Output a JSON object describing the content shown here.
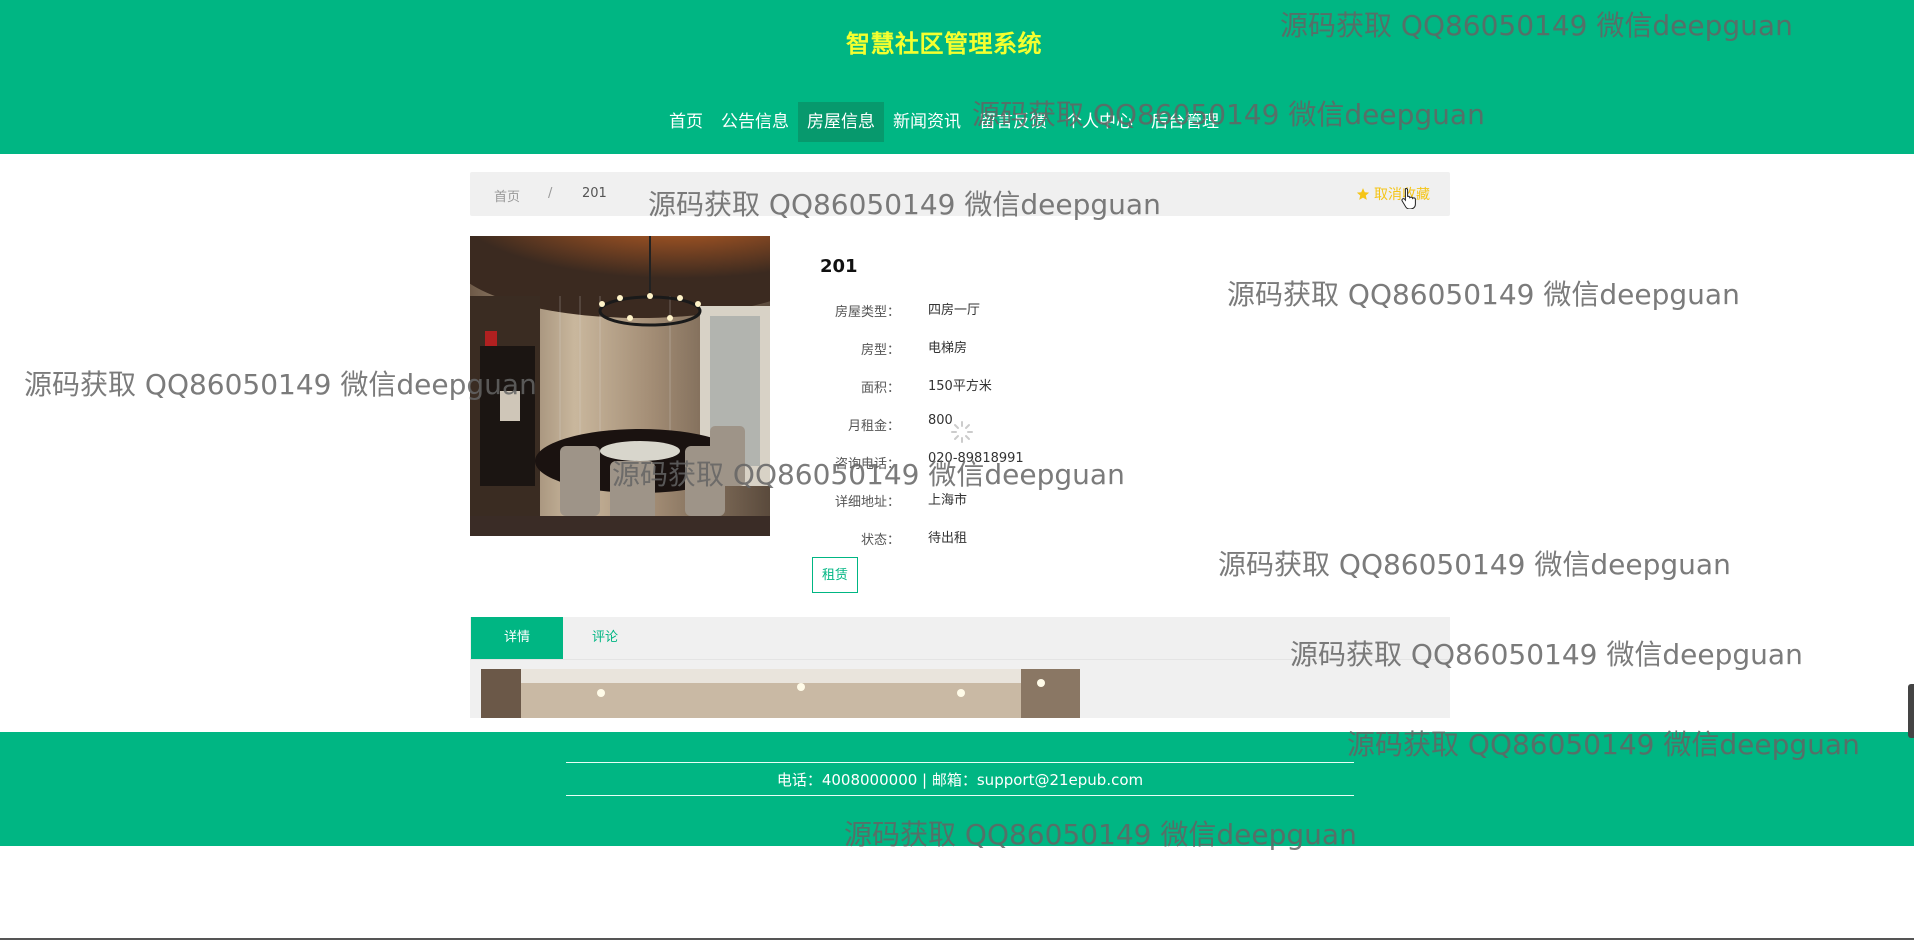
{
  "header": {
    "site_title": "智慧社区管理系统",
    "nav": [
      {
        "label": "首页",
        "active": false
      },
      {
        "label": "公告信息",
        "active": false
      },
      {
        "label": "房屋信息",
        "active": true
      },
      {
        "label": "新闻资讯",
        "active": false
      },
      {
        "label": "留言反馈",
        "active": false
      },
      {
        "label": "个人中心",
        "active": false
      },
      {
        "label": "后台管理",
        "active": false
      }
    ]
  },
  "breadcrumb": {
    "home": "首页",
    "separator": "/",
    "current": "201",
    "favorite_label": "取消收藏",
    "favorite_icon": "star-icon"
  },
  "detail": {
    "title": "201",
    "fields": [
      {
        "label": "房屋类型：",
        "value": "四房一厅"
      },
      {
        "label": "房型：",
        "value": "电梯房"
      },
      {
        "label": "面积：",
        "value": "150平方米"
      },
      {
        "label": "月租金：",
        "value": "800"
      },
      {
        "label": "咨询电话：",
        "value": "020-89818991"
      },
      {
        "label": "详细地址：",
        "value": "上海市"
      },
      {
        "label": "状态：",
        "value": "待出租"
      }
    ],
    "rent_button": "租赁"
  },
  "tabs": [
    {
      "label": "详情",
      "active": true
    },
    {
      "label": "评论",
      "active": false
    }
  ],
  "footer": {
    "contact": "电话：4008000000 | 邮箱：support@21epub.com"
  },
  "watermark": "源码获取 QQ86050149 微信deepguan",
  "colors": {
    "brand": "#00b683",
    "nav_active": "#07996d",
    "title": "#f4ff2f",
    "favorite": "#f5c518"
  }
}
